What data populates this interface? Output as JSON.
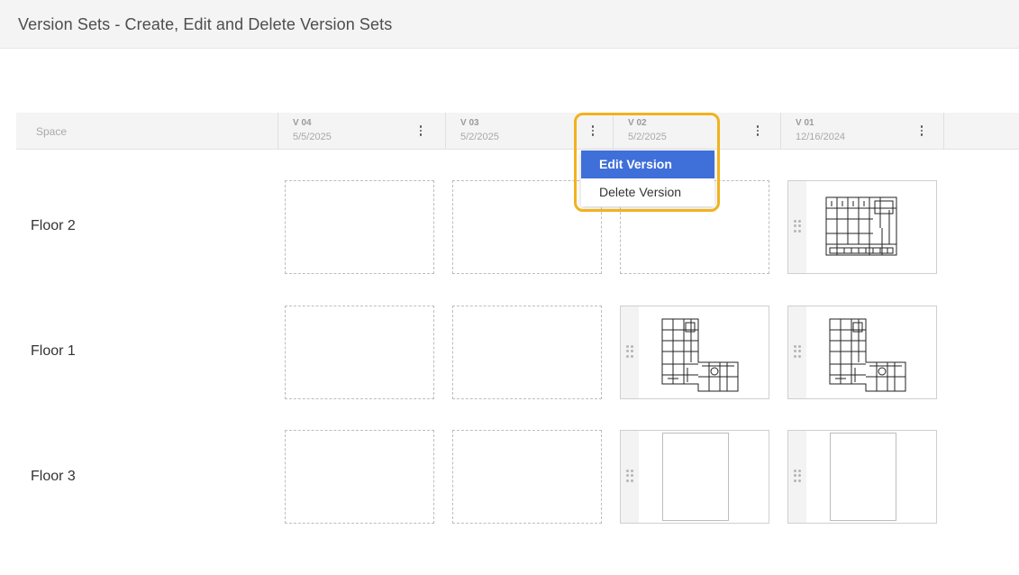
{
  "page_title": "Version Sets - Create, Edit and Delete Version Sets",
  "grid": {
    "space_header": "Space",
    "versions": [
      {
        "name": "V 04",
        "date": "5/5/2025"
      },
      {
        "name": "V 03",
        "date": "5/2/2025"
      },
      {
        "name": "V 02",
        "date": "5/2/2025"
      },
      {
        "name": "V 01",
        "date": "12/16/2024"
      }
    ],
    "rows": [
      {
        "label": "Floor 2",
        "cells": [
          "empty",
          "empty",
          "empty",
          "floorplan-floor2"
        ]
      },
      {
        "label": "Floor 1",
        "cells": [
          "empty",
          "empty",
          "floorplan-floor1",
          "floorplan-floor1"
        ]
      },
      {
        "label": "Floor 3",
        "cells": [
          "empty",
          "empty",
          "blank-sheet",
          "blank-sheet"
        ]
      }
    ]
  },
  "context_menu": {
    "open_for": "V 02",
    "items": [
      {
        "label": "Edit Version",
        "active": true
      },
      {
        "label": "Delete Version",
        "active": false
      }
    ]
  },
  "colors": {
    "menu_active": "#3f6fd8",
    "highlight": "#f2b21d"
  }
}
